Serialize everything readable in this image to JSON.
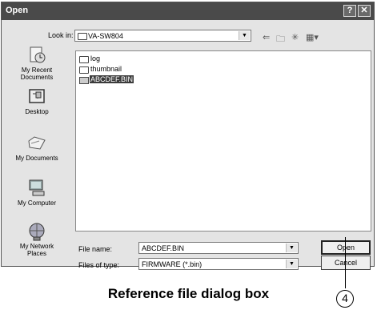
{
  "window": {
    "title": "Open",
    "help_glyph": "?",
    "close_glyph": "✕"
  },
  "lookin": {
    "label": "Look in:",
    "value": "VA-SW804"
  },
  "places": [
    {
      "icon": "recent-documents-icon",
      "label_line1": "My Recent",
      "label_line2": "Documents"
    },
    {
      "icon": "desktop-icon",
      "label_line1": "Desktop",
      "label_line2": ""
    },
    {
      "icon": "my-documents-icon",
      "label_line1": "My Documents",
      "label_line2": ""
    },
    {
      "icon": "my-computer-icon",
      "label_line1": "My Computer",
      "label_line2": ""
    },
    {
      "icon": "my-network-places-icon",
      "label_line1": "My Network",
      "label_line2": "Places"
    }
  ],
  "files": [
    {
      "name": "log",
      "type": "folder"
    },
    {
      "name": "thumbnail",
      "type": "folder"
    },
    {
      "name": "ABCDEF.BIN",
      "type": "file",
      "selected": true
    }
  ],
  "filename": {
    "label": "File name:",
    "value": "ABCDEF.BIN"
  },
  "filetype": {
    "label": "Files of type:",
    "value": "FIRMWARE (*.bin)"
  },
  "buttons": {
    "open": "Open",
    "cancel": "Cancel"
  },
  "caption": "Reference file dialog box",
  "callout": "4",
  "colors": {
    "titlebar": "#4a4a4a",
    "dialog": "#e4e4e4",
    "selection": "#3b3b3b"
  }
}
